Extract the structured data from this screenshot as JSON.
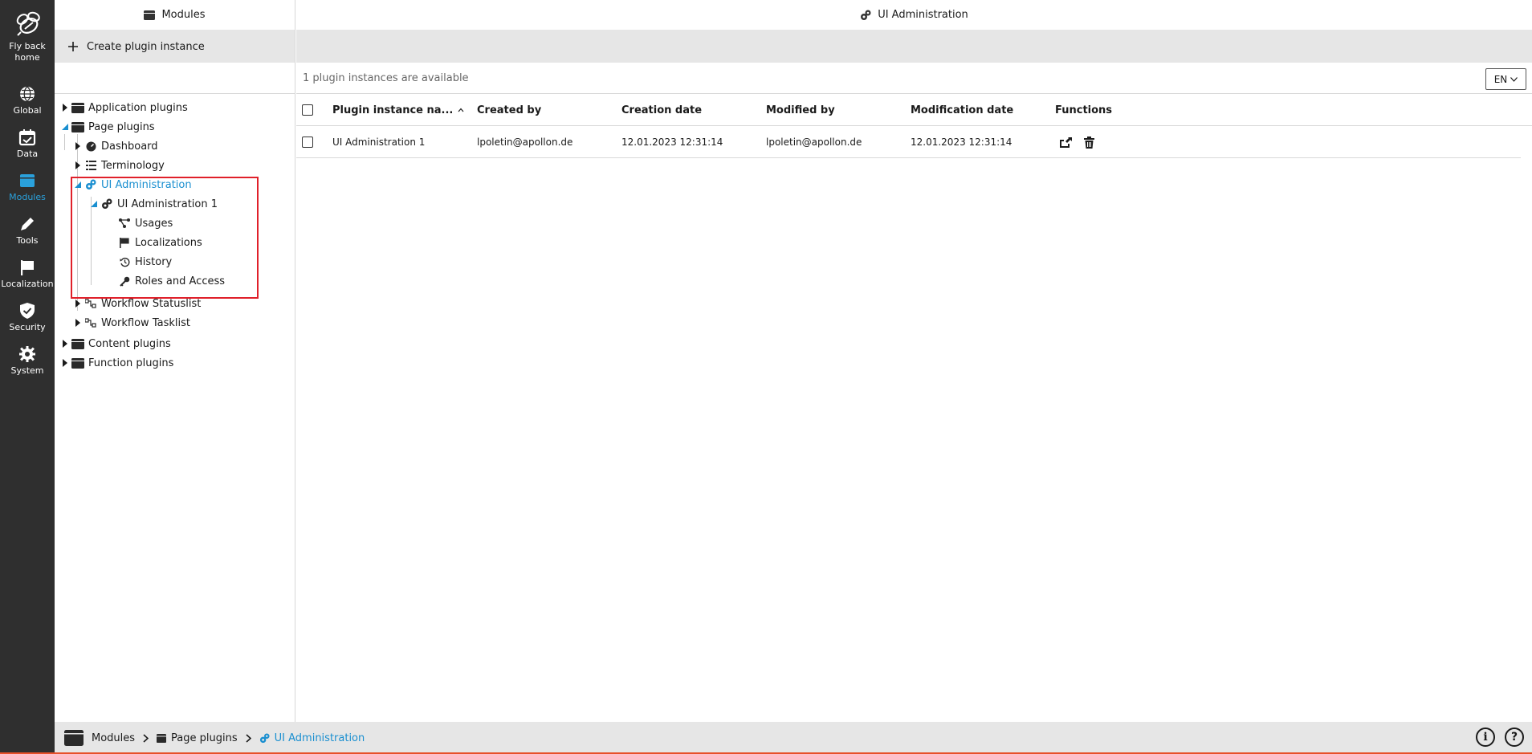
{
  "nav": {
    "logo_label": "Fly back home",
    "items": [
      {
        "label": "Global"
      },
      {
        "label": "Data"
      },
      {
        "label": "Modules",
        "active": true
      },
      {
        "label": "Tools"
      },
      {
        "label": "Localization"
      },
      {
        "label": "Security"
      },
      {
        "label": "System"
      }
    ]
  },
  "tree_panel": {
    "title": "Modules",
    "create_button_label": "Create plugin instance"
  },
  "tree": {
    "application_plugins": "Application plugins",
    "page_plugins": "Page plugins",
    "dashboard": "Dashboard",
    "terminology": "Terminology",
    "ui_administration": "UI Administration",
    "ui_administration_1": "UI Administration 1",
    "usages": "Usages",
    "localizations": "Localizations",
    "history": "History",
    "roles_and_access": "Roles and Access",
    "workflow_statuslist": "Workflow Statuslist",
    "workflow_tasklist": "Workflow Tasklist",
    "content_plugins": "Content plugins",
    "function_plugins": "Function plugins"
  },
  "main_panel": {
    "title": "UI Administration",
    "available_text": "1 plugin instances are available",
    "language": "EN"
  },
  "table": {
    "columns": {
      "name": "Plugin instance na...",
      "created_by": "Created by",
      "creation_date": "Creation date",
      "modified_by": "Modified by",
      "modification_date": "Modification date",
      "functions": "Functions"
    },
    "rows": [
      {
        "name": "UI Administration 1",
        "created_by": "lpoletin@apollon.de",
        "creation_date": "12.01.2023 12:31:14",
        "modified_by": "lpoletin@apollon.de",
        "modification_date": "12.01.2023 12:31:14"
      }
    ]
  },
  "breadcrumb": {
    "items": [
      "Modules",
      "Page plugins",
      "UI Administration"
    ]
  },
  "colors": {
    "accent": "#1a8fd0",
    "nav_bg": "#2f2f2f",
    "highlight": "#e0202a"
  }
}
